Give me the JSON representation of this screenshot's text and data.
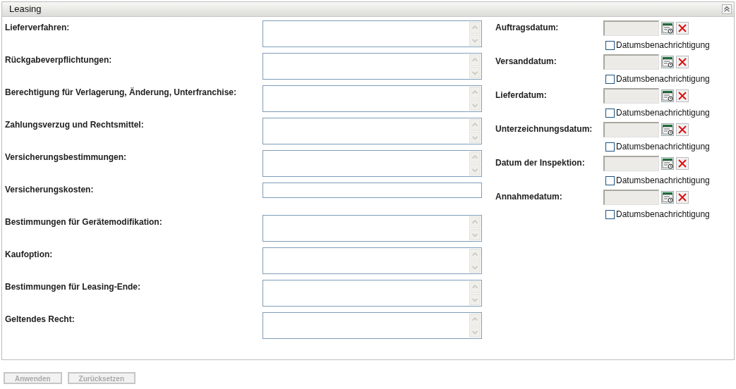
{
  "panel": {
    "title": "Leasing",
    "expanded": true
  },
  "fields": [
    {
      "label": "Lieferverfahren:",
      "kind": "textarea"
    },
    {
      "label": "Rückgabeverpflichtungen:",
      "kind": "textarea"
    },
    {
      "label": "Berechtigung für Verlagerung, Änderung, Unterfranchise:",
      "kind": "textarea"
    },
    {
      "label": "Zahlungsverzug und Rechtsmittel:",
      "kind": "textarea"
    },
    {
      "label": "Versicherungsbestimmungen:",
      "kind": "textarea"
    },
    {
      "label": "Versicherungskosten:",
      "kind": "input"
    },
    {
      "label": "Bestimmungen für Gerätemodifikation:",
      "kind": "textarea"
    },
    {
      "label": "Kaufoption:",
      "kind": "textarea"
    },
    {
      "label": "Bestimmungen für Leasing-Ende:",
      "kind": "textarea"
    },
    {
      "label": "Geltendes Recht:",
      "kind": "textarea"
    }
  ],
  "date_fields": [
    {
      "label": "Auftragsdatum:",
      "notify_label": "Datumsbenachrichtigung",
      "checked": false
    },
    {
      "label": "Versanddatum:",
      "notify_label": "Datumsbenachrichtigung",
      "checked": false
    },
    {
      "label": "Lieferdatum:",
      "notify_label": "Datumsbenachrichtigung",
      "checked": false
    },
    {
      "label": "Unterzeichnungsdatum:",
      "notify_label": "Datumsbenachrichtigung",
      "checked": false
    },
    {
      "label": "Datum der Inspektion:",
      "notify_label": "Datumsbenachrichtigung",
      "checked": false
    },
    {
      "label": "Annahmedatum:",
      "notify_label": "Datumsbenachrichtigung",
      "checked": false
    }
  ],
  "buttons": [
    {
      "label": "Anwenden",
      "disabled": true
    },
    {
      "label": "Zurücksetzen",
      "disabled": true
    }
  ]
}
